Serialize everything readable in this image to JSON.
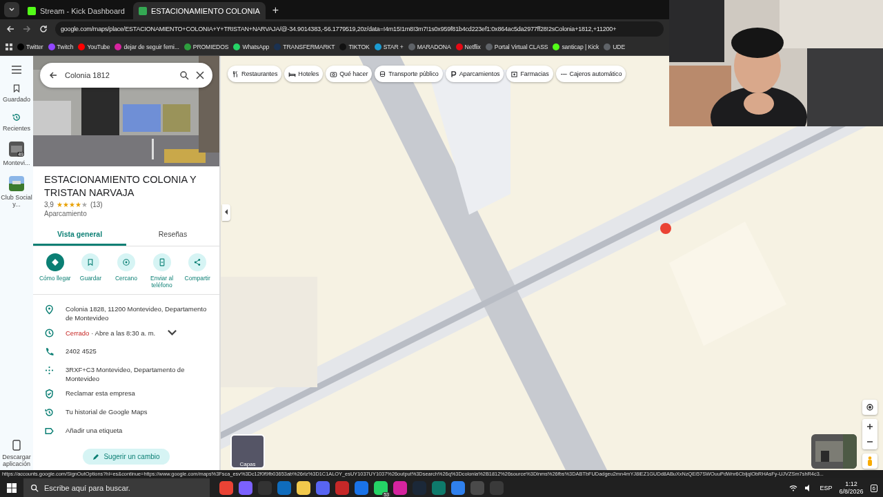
{
  "browser": {
    "tabs": [
      {
        "title": "Stream - Kick Dashboard",
        "selected": false
      },
      {
        "title": "ESTACIONAMIENTO COLONIA",
        "selected": true
      }
    ],
    "new_tab": "+",
    "address": "google.com/maps/place/ESTACIONAMIENTO+COLONIA+Y+TRISTAN+NARVAJA/@-34.9014383,-56.1779519,20z/data=!4m15!1m8!3m7!1s0x959f81b4cd223ef1:0x864ac5da2977ff28!2sColonia+1812,+11200+",
    "bookmarks": [
      {
        "label": "Twitter",
        "color": "#000000"
      },
      {
        "label": "Twitch",
        "color": "#9146ff"
      },
      {
        "label": "YouTube",
        "color": "#ff0000"
      },
      {
        "label": "dejar de seguir femi...",
        "color": "#d6249f"
      },
      {
        "label": "PROMIEDOS",
        "color": "#2e9e3e"
      },
      {
        "label": "WhatsApp",
        "color": "#25d366"
      },
      {
        "label": "TRANSFERMARKT",
        "color": "#1a3151"
      },
      {
        "label": "TIKTOK",
        "color": "#111111"
      },
      {
        "label": "STAR +",
        "color": "#1b9bd1"
      },
      {
        "label": "MARADONA",
        "color": "#5f6368"
      },
      {
        "label": "Netflix",
        "color": "#e50914"
      },
      {
        "label": "Portal Virtual CLASS",
        "color": "#5f6368"
      },
      {
        "label": "santicap | Kick",
        "color": "#53fc18"
      },
      {
        "label": "UDE",
        "color": "#5f6368"
      }
    ]
  },
  "rail": {
    "items": [
      {
        "label": "Guardado",
        "kind": "saved"
      },
      {
        "label": "Recientes",
        "kind": "recent"
      }
    ],
    "places": [
      {
        "label": "Montevi...",
        "badge": "49"
      },
      {
        "label": "Club Social y..."
      }
    ],
    "download": "Descargar aplicación"
  },
  "search": {
    "value": "Colonia 1812"
  },
  "place": {
    "title": "ESTACIONAMIENTO COLONIA Y TRISTAN NARVAJA",
    "rating": "3,9",
    "stars": 4,
    "reviews": "(13)",
    "category": "Aparcamiento",
    "tabs": [
      {
        "label": "Vista general",
        "selected": true
      },
      {
        "label": "Reseñas",
        "selected": false
      }
    ],
    "actions": [
      {
        "label": "Cómo llegar",
        "kind": "directions"
      },
      {
        "label": "Guardar",
        "kind": "save"
      },
      {
        "label": "Cercano",
        "kind": "nearby"
      },
      {
        "label": "Enviar al teléfono",
        "kind": "phone"
      },
      {
        "label": "Compartir",
        "kind": "share"
      }
    ],
    "info": [
      {
        "kind": "pin",
        "text": "Colonia 1828, 11200 Montevideo, Departamento de Montevideo"
      },
      {
        "kind": "clock",
        "status": "Cerrado",
        "text": "· Abre a las 8:30 a. m."
      },
      {
        "kind": "call",
        "text": "2402 4525"
      },
      {
        "kind": "pluscode",
        "text": "3RXF+C3 Montevideo, Departamento de Montevideo"
      },
      {
        "kind": "shield",
        "text": "Reclamar esta empresa"
      },
      {
        "kind": "history",
        "text": "Tu historial de Google Maps"
      },
      {
        "kind": "label",
        "text": "Añadir una etiqueta"
      }
    ],
    "suggest": "Sugerir un cambio"
  },
  "map": {
    "chips": [
      {
        "label": "Restaurantes",
        "kind": "fork"
      },
      {
        "label": "Hoteles",
        "kind": "bed"
      },
      {
        "label": "Qué hacer",
        "kind": "camera"
      },
      {
        "label": "Transporte público",
        "kind": "bus"
      },
      {
        "label": "Aparcamientos",
        "kind": "parking"
      },
      {
        "label": "Farmacias",
        "kind": "pharmacy"
      },
      {
        "label": "Cajeros automático",
        "kind": "atm"
      }
    ],
    "layers": "Capas"
  },
  "status_url": "https://accounts.google.com/SignOutOptions?hl=es&continue=https://www.google.com/maps%3Fsca_esv%3Dc12f0f9fb03653ab%26rlz%3D1C1ALOY_esUY1037UY1037%26output%3Dsearch%26q%3Dcolonia%2B1812%26source%3Dlnms%26fbs%3DABTbFUDadgeu2mn4mYJ8iEZ1GUDd8ABuXxNzQEi57SWOuuPdWnr6CbijqlObRHAsFy-UJVZSm7shR4c3...",
  "taskbar": {
    "search_placeholder": "Escribe aquí para buscar.",
    "apps": [
      {
        "color": "#ea4335"
      },
      {
        "color": "#7b61ff"
      },
      {
        "color": "#333333"
      },
      {
        "color": "#0f6cbd"
      },
      {
        "color": "#f2c94c"
      },
      {
        "color": "#5865f2"
      },
      {
        "color": "#c62828"
      },
      {
        "color": "#1a73e8"
      },
      {
        "color": "#25d366",
        "badge": "53"
      },
      {
        "color": "#d6249f"
      },
      {
        "color": "#1b2838"
      },
      {
        "color": "#0e7a6b"
      },
      {
        "color": "#2f80ed"
      },
      {
        "color": "#4a4a4a"
      },
      {
        "color": "#3a3a3a"
      }
    ],
    "language": "ESP",
    "time": "1:12",
    "date": "6/8/2026",
    "notifications": "6"
  }
}
